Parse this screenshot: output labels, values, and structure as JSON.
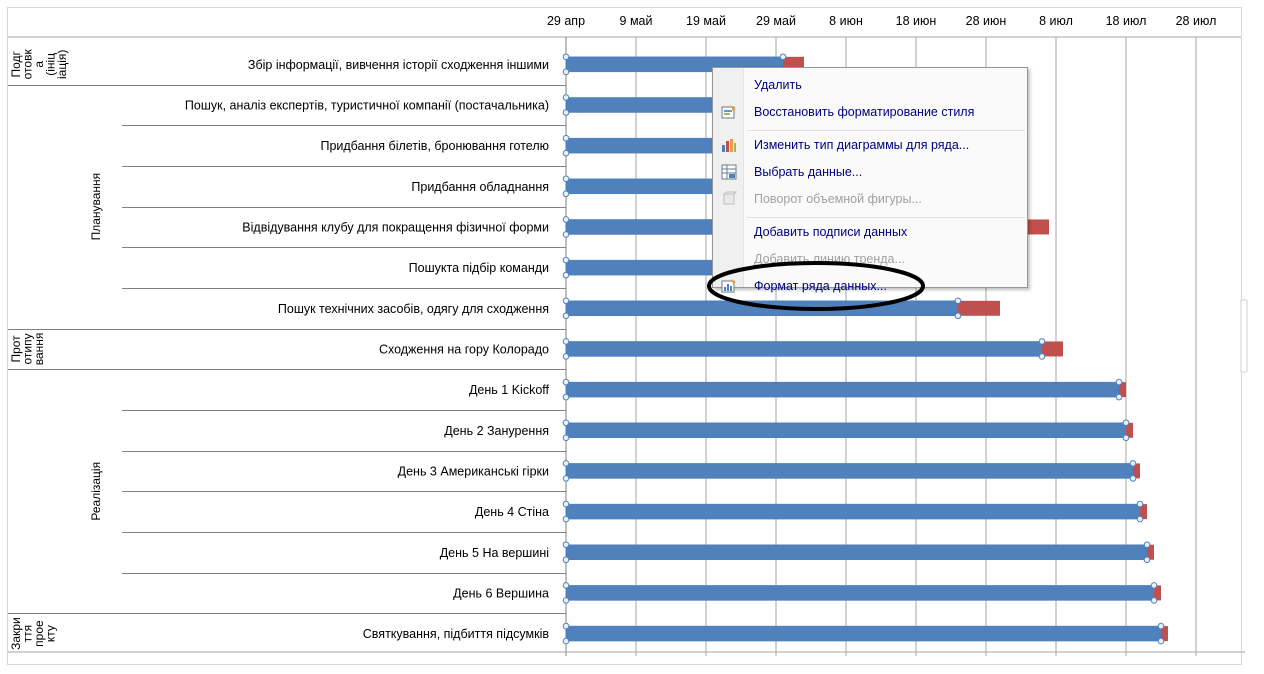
{
  "chart_data": {
    "type": "bar",
    "orientation": "horizontal",
    "stacked": true,
    "x_ticks": [
      "29 апр",
      "9 май",
      "19 май",
      "29 май",
      "8 июн",
      "18 июн",
      "28 июн",
      "8 июл",
      "18 июл",
      "28 июл"
    ],
    "x_type": "date",
    "xlim": [
      "2024-04-29",
      "2024-08-01"
    ],
    "grid": true,
    "categories": [
      "Збір інформації, вивчення історії сходження іншими",
      "Пошук, аналіз експертів, туристичної компанії (постачальника)",
      "Придбання білетів, бронювання готелю",
      "Придбання обладнання",
      "Відвідування клубу для покращення фізичної форми",
      "Пошук та підбір команди",
      "Пошук технічних засобів, одягу для сходження",
      "Сходження на гору Колорадо",
      "День 1 Kickoff",
      "День 2 Занурення",
      "День 3 Американські гірки",
      "День 4 Стіна",
      "День 5 На вершині",
      "День 6 Вершина",
      "Святкування, підбиття підсумків"
    ],
    "category_labels_display": [
      "Збір інформації,  вивчення  історії сходження іншими",
      "Пошук, аналіз експертів, туристичної компанії (постачальника)",
      "Придбання білетів, бронювання  готелю",
      "Придбання обладнання",
      "Відвідування  клубу для покращення фізичної форми",
      "Пошукта підбір команди",
      "Пошук технічних засобів, одягу для сходження",
      "Сходження на гору Колорадо",
      "День 1 Kickoff",
      "День 2 Занурення",
      "День 3 Американські гірки",
      "День 4 Стіна",
      "День 5 На вершині",
      "День 6 Вершина",
      "Святкування,  підбиття  підсумків"
    ],
    "series": [
      {
        "color": "#4f81bd",
        "start": [
          "2024-04-29",
          "2024-04-29",
          "2024-04-29",
          "2024-04-29",
          "2024-04-29",
          "2024-04-29",
          "2024-04-29",
          "2024-04-29",
          "2024-04-29",
          "2024-04-29",
          "2024-04-29",
          "2024-04-29",
          "2024-04-29",
          "2024-04-29",
          "2024-04-29"
        ],
        "end": [
          "2024-05-30",
          "2024-05-30",
          "2024-05-30",
          "2024-05-30",
          "2024-05-30",
          "2024-05-30",
          "2024-06-24",
          "2024-07-06",
          "2024-07-17",
          "2024-07-18",
          "2024-07-19",
          "2024-07-20",
          "2024-07-21",
          "2024-07-22",
          "2024-07-23"
        ]
      },
      {
        "color": "#c0504d",
        "start": [
          "2024-05-30",
          null,
          null,
          null,
          null,
          null,
          "2024-06-24",
          "2024-07-06",
          "2024-07-17",
          "2024-07-18",
          "2024-07-19",
          "2024-07-20",
          "2024-07-21",
          "2024-07-22",
          "2024-07-23"
        ],
        "end": [
          "2024-06-02",
          null,
          null,
          null,
          "2024-07-07",
          null,
          "2024-06-30",
          "2024-07-09",
          "2024-07-18",
          "2024-07-19",
          "2024-07-20",
          "2024-07-21",
          "2024-07-22",
          "2024-07-23",
          "2024-07-24"
        ]
      }
    ],
    "phases": [
      {
        "label": "Подготовка (ініціація)",
        "lines": [
          "Подг",
          "отовк",
          "а",
          "(ініц",
          "іація)"
        ],
        "rows": [
          0,
          0
        ]
      },
      {
        "label": "Планування",
        "lines": [
          "Планування"
        ],
        "rows": [
          1,
          6
        ]
      },
      {
        "label": "Прототипування",
        "lines": [
          "Прот",
          "отипу",
          "вання"
        ],
        "rows": [
          7,
          7
        ]
      },
      {
        "label": "Реалізація",
        "lines": [
          "Реалізація"
        ],
        "rows": [
          8,
          13
        ]
      },
      {
        "label": "Закриття проекту",
        "lines": [
          "Закри",
          "ття",
          "прое",
          "кту"
        ],
        "rows": [
          14,
          14
        ]
      }
    ]
  },
  "context_menu": {
    "items": [
      {
        "label": "Удалить",
        "enabled": true,
        "icon": null
      },
      {
        "label": "Восстановить форматирование стиля",
        "enabled": true,
        "icon": "reset-style-icon"
      },
      {
        "separator": true
      },
      {
        "label": "Изменить тип диаграммы для ряда...",
        "enabled": true,
        "icon": "chart-type-icon"
      },
      {
        "label": "Выбрать данные...",
        "enabled": true,
        "icon": "select-data-icon"
      },
      {
        "label": "Поворот объемной фигуры...",
        "enabled": false,
        "icon": "rotation-3d-icon"
      },
      {
        "separator": true
      },
      {
        "label": "Добавить подписи данных",
        "enabled": true,
        "icon": null
      },
      {
        "label": "Добавить линию тренда...",
        "enabled": false,
        "icon": null
      },
      {
        "label": "Формат ряда данных...",
        "enabled": true,
        "icon": "format-series-icon",
        "circled": true
      }
    ]
  }
}
